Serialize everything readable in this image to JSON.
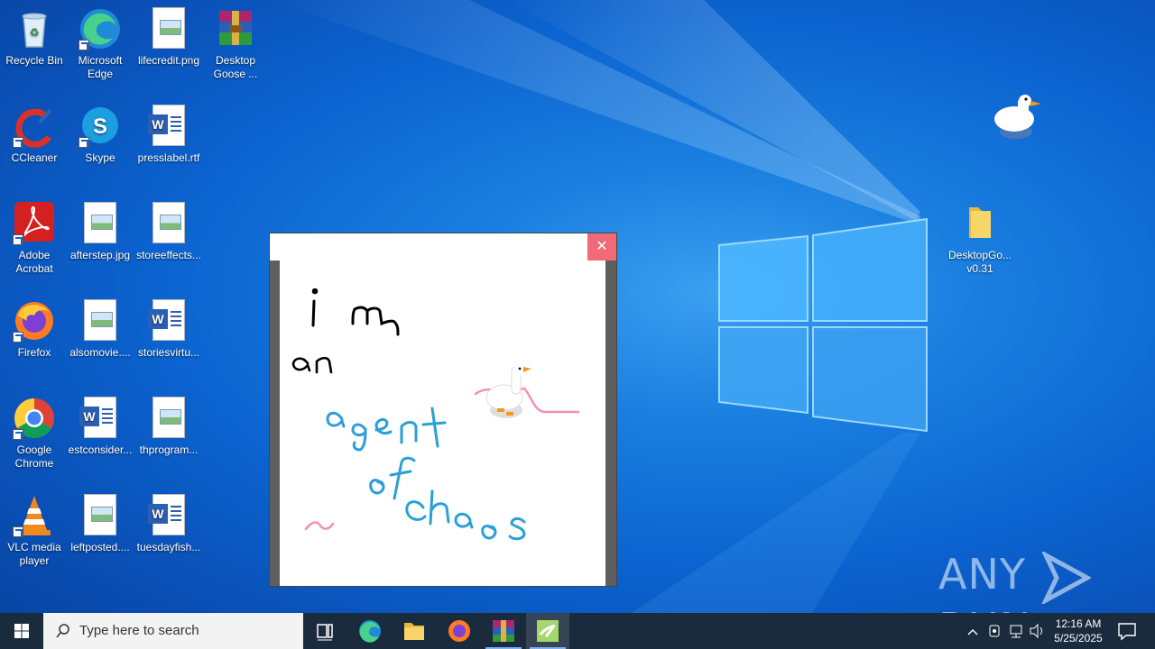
{
  "desktop": {
    "icons": [
      {
        "label": "Recycle Bin",
        "icon": "recycle-bin-icon"
      },
      {
        "label": "Microsoft Edge",
        "icon": "edge-icon"
      },
      {
        "label": "lifecredit.png",
        "icon": "image-file-icon"
      },
      {
        "label": "Desktop Goose ...",
        "icon": "winrar-archive-icon"
      },
      {
        "label": "CCleaner",
        "icon": "ccleaner-icon"
      },
      {
        "label": "Skype",
        "icon": "skype-icon"
      },
      {
        "label": "presslabel.rtf",
        "icon": "word-doc-icon"
      },
      {
        "label": "Adobe Acrobat",
        "icon": "acrobat-icon"
      },
      {
        "label": "afterstep.jpg",
        "icon": "image-file-icon"
      },
      {
        "label": "storeeffects...",
        "icon": "image-file-icon"
      },
      {
        "label": "Firefox",
        "icon": "firefox-icon"
      },
      {
        "label": "alsomovie....",
        "icon": "image-file-icon"
      },
      {
        "label": "storiesvirtu...",
        "icon": "word-doc-icon"
      },
      {
        "label": "Google Chrome",
        "icon": "chrome-icon"
      },
      {
        "label": "estconsider...",
        "icon": "word-doc-icon"
      },
      {
        "label": "thprogram...",
        "icon": "image-file-icon"
      },
      {
        "label": "VLC media player",
        "icon": "vlc-icon"
      },
      {
        "label": "leftposted....",
        "icon": "image-file-icon"
      },
      {
        "label": "tuesdayfish...",
        "icon": "word-doc-icon"
      },
      {
        "label": "DesktopGo... v0.31",
        "icon": "folder-icon"
      }
    ]
  },
  "popup": {
    "close_glyph": "✕",
    "drawing_text": [
      "i m",
      "an",
      "agent",
      "of",
      "chaos"
    ]
  },
  "watermark": {
    "text_left": "ANY",
    "text_right": "RUN"
  },
  "taskbar": {
    "search_placeholder": "Type here to search",
    "pinned": [
      "task-view",
      "edge",
      "file-explorer",
      "firefox",
      "winrar",
      "desktop-goose"
    ],
    "clock_time": "12:16 AM",
    "clock_date": "5/25/2025"
  },
  "colors": {
    "accent": "#0b63cf",
    "taskbar": "#1b2b3e",
    "close": "#f06a78"
  }
}
